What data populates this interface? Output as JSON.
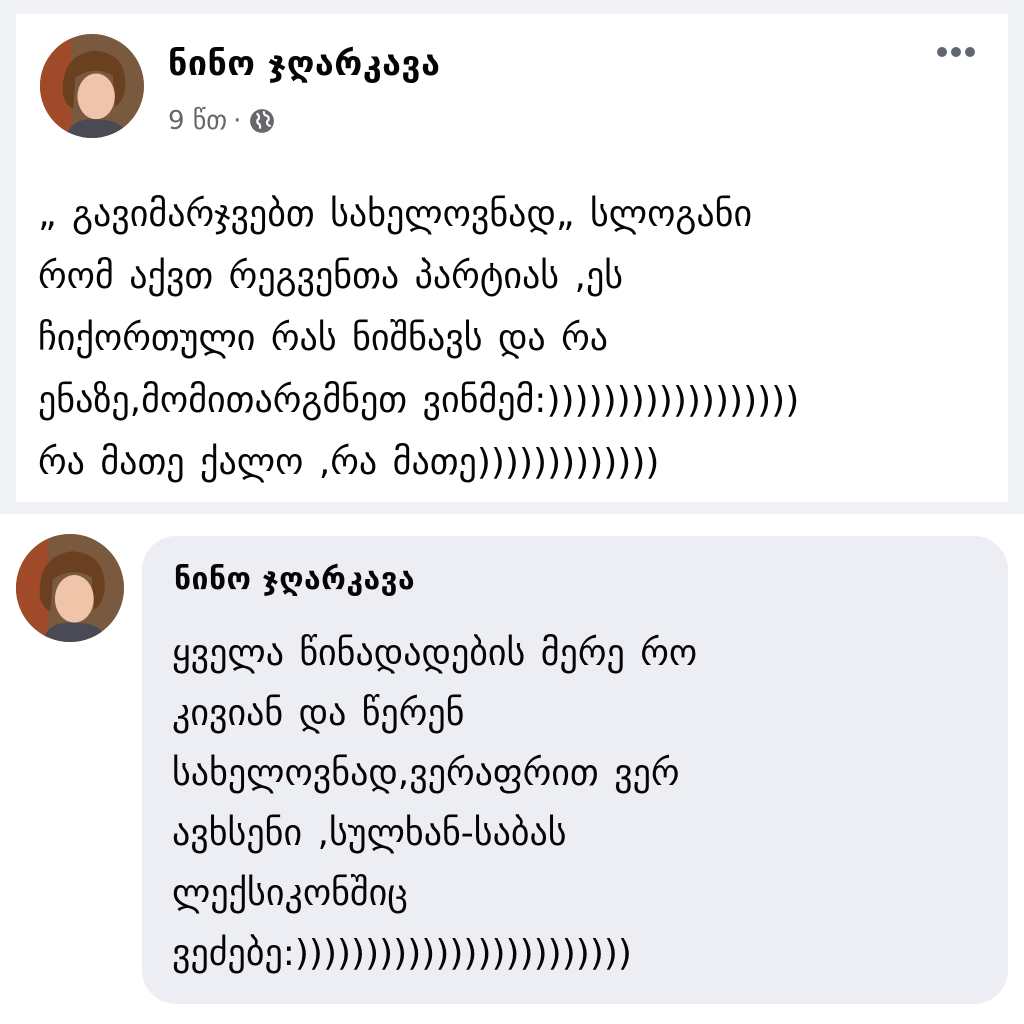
{
  "post": {
    "author": "ნინო ჯღარკავა",
    "time": "9 წთ",
    "separator": "·",
    "privacy_icon": "globe-icon",
    "menu_icon": "more-horizontal-icon",
    "text": "„ გავიმარჯვებთ სახელოვნად„ სლოგანი\nრომ აქვთ რეგვენთა პარტიას ,ეს\nჩიქორთული რას ნიშნავს და რა\nენაზე,მომითარგმნეთ ვინმემ:))))))))))))))))))\nრა მათე ქალო ,რა მათე)))))))))))))"
  },
  "comment": {
    "author": "ნინო ჯღარკავა",
    "text": "ყველა წინადადების მერე რო\nკივიან და წერენ\nსახელოვნად,ვერაფრით ვერ\nავხსენი ,სულხან-საბას\nლექსიკონშიც\nვეძებე:))))))))))))))))))))))))"
  },
  "colors": {
    "background": "#f0f2f5",
    "card": "#ffffff",
    "bubble": "#eceef3",
    "secondary_text": "#65676b"
  }
}
